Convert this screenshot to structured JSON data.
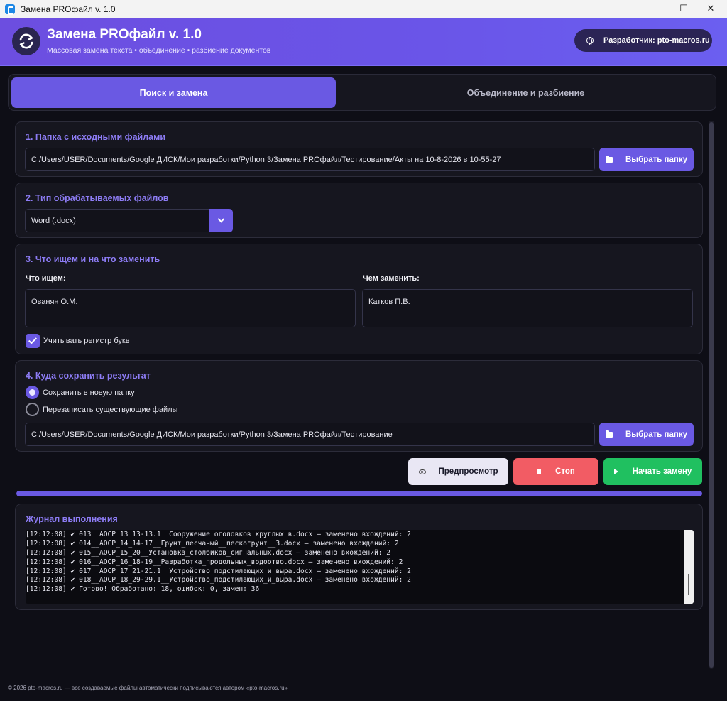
{
  "window": {
    "title": "Замена PROфайл v. 1.0",
    "minimize": "—",
    "maximize": "☐",
    "close": "✕"
  },
  "header": {
    "title": "Замена PROфайл v. 1.0",
    "subtitle": "Массовая замена текста  •  объединение  •  разбиение документов",
    "dev_label": "Разработчик: pto-macros.ru"
  },
  "tabs": [
    {
      "label": "Поиск и замена",
      "active": true
    },
    {
      "label": "Объединение и разбиение",
      "active": false
    }
  ],
  "section1": {
    "title": "1.  Папка с исходными файлами",
    "path": "C:/Users/USER/Documents/Google ДИСК/Мои разработки/Python 3/Замена PROфайл/Тестирование/Акты на 10-8-2026 в 10-55-27",
    "button": "Выбрать папку"
  },
  "section2": {
    "title": "2.  Тип обрабатываемых файлов",
    "selected": "Word (.docx)"
  },
  "section3": {
    "title": "3.  Что ищем и на что заменить",
    "find_label": "Что ищем:",
    "find_value": "Ованян О.М.",
    "replace_label": "Чем заменить:",
    "replace_value": "Катков П.В.",
    "case_label": "Учитывать регистр букв",
    "case_checked": true
  },
  "section4": {
    "title": "4.  Куда сохранить результат",
    "option_new": "Сохранить в новую папку",
    "option_overwrite": "Перезаписать существующие файлы",
    "selected": "new",
    "path": "C:/Users/USER/Documents/Google ДИСК/Мои разработки/Python 3/Замена PROфайл/Тестирование",
    "button": "Выбрать папку"
  },
  "actions": {
    "preview": "Предпросмотр",
    "stop": "Стоп",
    "start": "Начать замену"
  },
  "progress": {
    "percent": 100
  },
  "log": {
    "title": "Журнал выполнения",
    "lines": [
      "[12:12:08] ✔ 013__АОСР_13_13-13.1__Сооружение_оголовков_круглых_в.docx — заменено вхождений: 2",
      "[12:12:08] ✔ 014__АОСР_14_14-17__Грунт_песчаный__пескогрунт__3.docx — заменено вхождений: 2",
      "[12:12:08] ✔ 015__АОСР_15_20__Установка_столбиков_сигнальных.docx — заменено вхождений: 2",
      "[12:12:08] ✔ 016__АОСР_16_18-19__Разработка_продольных_водоотво.docx — заменено вхождений: 2",
      "[12:12:08] ✔ 017__АОСР_17_21-21.1__Устройство_подстилающих_и_выра.docx — заменено вхождений: 2",
      "[12:12:08] ✔ 018__АОСР_18_29-29.1__Устройство_подстилающих_и_выра.docx — заменено вхождений: 2",
      "[12:12:08] ✔ Готово! Обработано: 18, ошибок: 0, замен: 36"
    ]
  },
  "footer": "© 2026 pto-macros.ru — все создаваемые файлы автоматически подписываются автором «pto-macros.ru»"
}
